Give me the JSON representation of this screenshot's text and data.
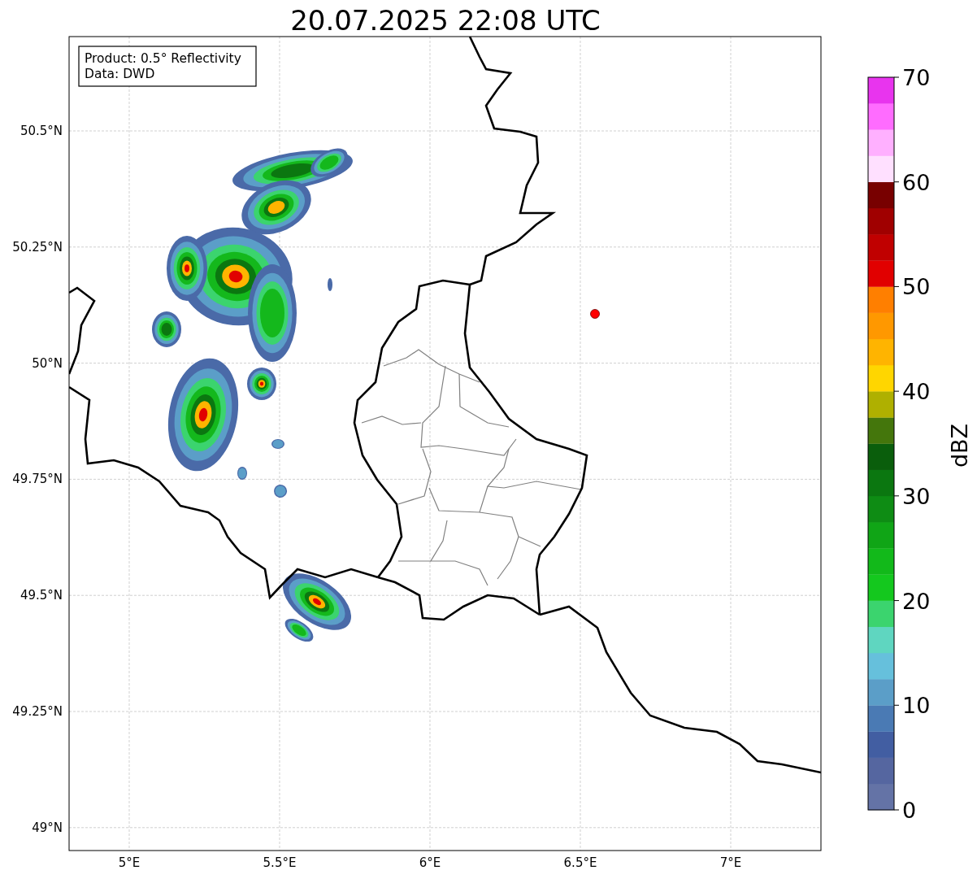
{
  "title": "20.07.2025 22:08 UTC",
  "info_box": [
    "Product: 0.5° Reflectivity",
    "Data: DWD"
  ],
  "map": {
    "x_ticks": [
      "5°E",
      "5.5°E",
      "6°E",
      "6.5°E",
      "7°E"
    ],
    "y_ticks": [
      "50.5°N",
      "50.25°N",
      "50°N",
      "49.75°N",
      "49.5°N",
      "49.25°N",
      "49°N"
    ]
  },
  "colorbar": {
    "label": "dBZ",
    "ticks": [
      "70",
      "60",
      "50",
      "40",
      "30",
      "20",
      "10",
      "0"
    ],
    "segments": [
      {
        "color": "#6473a6"
      },
      {
        "color": "#5566a0"
      },
      {
        "color": "#425ea2"
      },
      {
        "color": "#4a7ab4"
      },
      {
        "color": "#5b9ec8"
      },
      {
        "color": "#66c0dc"
      },
      {
        "color": "#5fd6c0"
      },
      {
        "color": "#3bd46e"
      },
      {
        "color": "#14c81e"
      },
      {
        "color": "#12b91a"
      },
      {
        "color": "#10a516"
      },
      {
        "color": "#0e8c14"
      },
      {
        "color": "#0b7710"
      },
      {
        "color": "#0a5e0c"
      },
      {
        "color": "#44760c"
      },
      {
        "color": "#afb000"
      },
      {
        "color": "#ffd600"
      },
      {
        "color": "#ffb400"
      },
      {
        "color": "#ff9800"
      },
      {
        "color": "#ff7f00"
      },
      {
        "color": "#e10000"
      },
      {
        "color": "#c00000"
      },
      {
        "color": "#a00000"
      },
      {
        "color": "#780000"
      },
      {
        "color": "#ffe0ff"
      },
      {
        "color": "#ffb0ff"
      },
      {
        "color": "#ff6cff"
      },
      {
        "color": "#e834ee"
      }
    ]
  }
}
